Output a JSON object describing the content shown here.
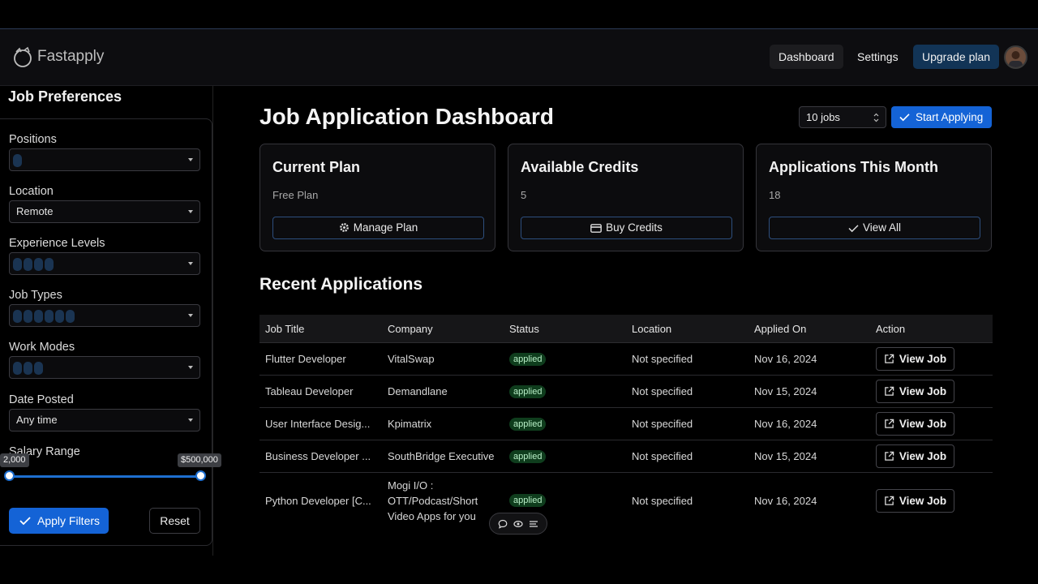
{
  "app": {
    "name": "Fastapply"
  },
  "nav": {
    "dashboard": "Dashboard",
    "settings": "Settings",
    "upgrade": "Upgrade plan"
  },
  "sidebar": {
    "title": "Job Preferences",
    "positions_label": "Positions",
    "location_label": "Location",
    "location_value": "Remote",
    "experience_label": "Experience Levels",
    "job_types_label": "Job Types",
    "work_modes_label": "Work Modes",
    "date_posted_label": "Date Posted",
    "date_posted_value": "Any time",
    "salary_label": "Salary Range",
    "salary_min": "2,000",
    "salary_max": "$500,000",
    "apply_label": "Apply Filters",
    "reset_label": "Reset"
  },
  "main": {
    "title": "Job Application Dashboard",
    "jobs_select": "10 jobs",
    "start_label": "Start Applying",
    "cards": [
      {
        "title": "Current Plan",
        "value": "Free Plan",
        "button": "Manage Plan"
      },
      {
        "title": "Available Credits",
        "value": "5",
        "button": "Buy Credits"
      },
      {
        "title": "Applications This Month",
        "value": "18",
        "button": "View All"
      }
    ],
    "recent_title": "Recent Applications",
    "columns": [
      "Job Title",
      "Company",
      "Status",
      "Location",
      "Applied On",
      "Action"
    ],
    "rows": [
      {
        "title": "Flutter Developer",
        "company": "VitalSwap",
        "status": "applied",
        "location": "Not specified",
        "date": "Nov 16, 2024",
        "action": "View Job"
      },
      {
        "title": "Tableau Developer",
        "company": "Demandlane",
        "status": "applied",
        "location": "Not specified",
        "date": "Nov 15, 2024",
        "action": "View Job"
      },
      {
        "title": "User Interface Desig...",
        "company": "Kpimatrix",
        "status": "applied",
        "location": "Not specified",
        "date": "Nov 16, 2024",
        "action": "View Job"
      },
      {
        "title": "Business Developer ...",
        "company": "SouthBridge Executive",
        "status": "applied",
        "location": "Not specified",
        "date": "Nov 15, 2024",
        "action": "View Job"
      },
      {
        "title": "Python Developer [C...",
        "company": "Mogi I/O :\nOTT/Podcast/Short\nVideo Apps for you",
        "status": "applied",
        "location": "Not specified",
        "date": "Nov 16, 2024",
        "action": "View Job"
      }
    ]
  },
  "colors": {
    "accent": "#1463d6",
    "badge_bg": "#0f3d1d",
    "upgrade_bg": "#123456"
  }
}
